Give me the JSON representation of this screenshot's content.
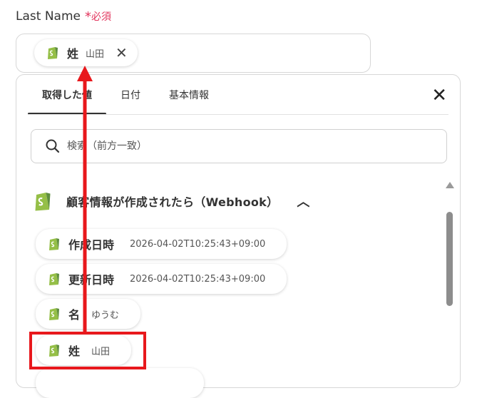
{
  "field": {
    "label": "Last Name",
    "required_star": "*",
    "required_text": "必須",
    "chip_key": "姓",
    "chip_value": "山田",
    "chip_close": "✕"
  },
  "tabs": [
    "取得した値",
    "日付",
    "基本情報"
  ],
  "panel_close": "✕",
  "search": {
    "placeholder": "検索（前方一致）"
  },
  "section": {
    "title": "顧客情報が作成されたら（Webhook）",
    "chevron": "︿"
  },
  "items": [
    {
      "key": "作成日時",
      "value": "2026-04-02T10:25:43+09:00"
    },
    {
      "key": "更新日時",
      "value": "2026-04-02T10:25:43+09:00"
    },
    {
      "key": "名",
      "value": "ゆうむ"
    },
    {
      "key": "姓",
      "value": "山田"
    }
  ],
  "colors": {
    "accent_red": "#e8181c",
    "required": "#e2365e",
    "shopify_green": "#95bf47"
  }
}
